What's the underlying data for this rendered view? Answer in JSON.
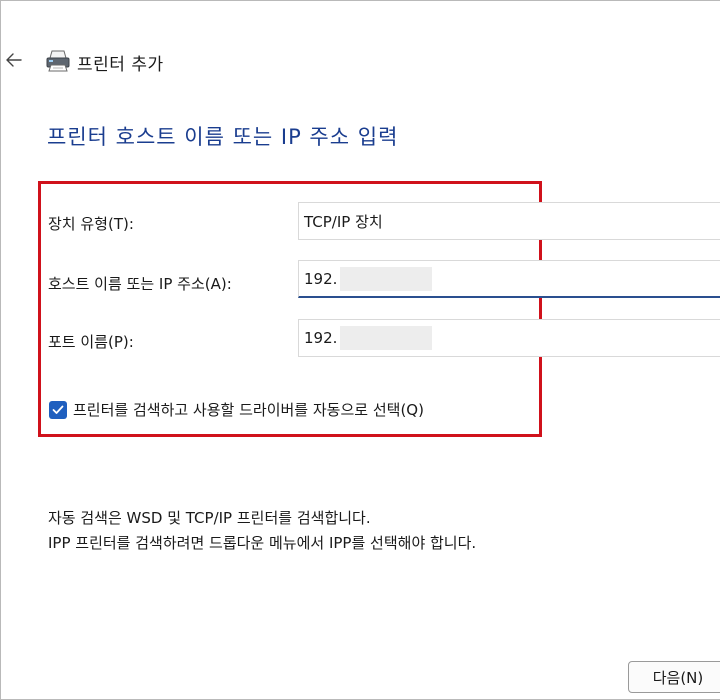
{
  "header": {
    "title": "프린터 추가",
    "back_icon": "arrow-left-icon",
    "printer_icon": "printer-icon"
  },
  "page": {
    "heading": "프린터 호스트 이름 또는 IP 주소 입력"
  },
  "form": {
    "device_type": {
      "label": "장치 유형(T):",
      "value": "TCP/IP 장치"
    },
    "hostname": {
      "label": "호스트 이름 또는 IP 주소(A):",
      "value": "192."
    },
    "port_name": {
      "label": "포트 이름(P):",
      "value": "192."
    },
    "auto_select": {
      "label": "프린터를 검색하고 사용할 드라이버를 자동으로 선택(Q)",
      "checked": true
    }
  },
  "info": {
    "line1": "자동 검색은 WSD 및 TCP/IP 프린터를 검색합니다.",
    "line2": "IPP 프린터를 검색하려면 드롭다운 메뉴에서 IPP를 선택해야 합니다."
  },
  "footer": {
    "next_label": "다음(N)"
  },
  "colors": {
    "heading": "#1a3d8f",
    "highlight_border": "#d0111b",
    "checkbox": "#1f5fbf",
    "active_underline": "#2a4f8f"
  }
}
